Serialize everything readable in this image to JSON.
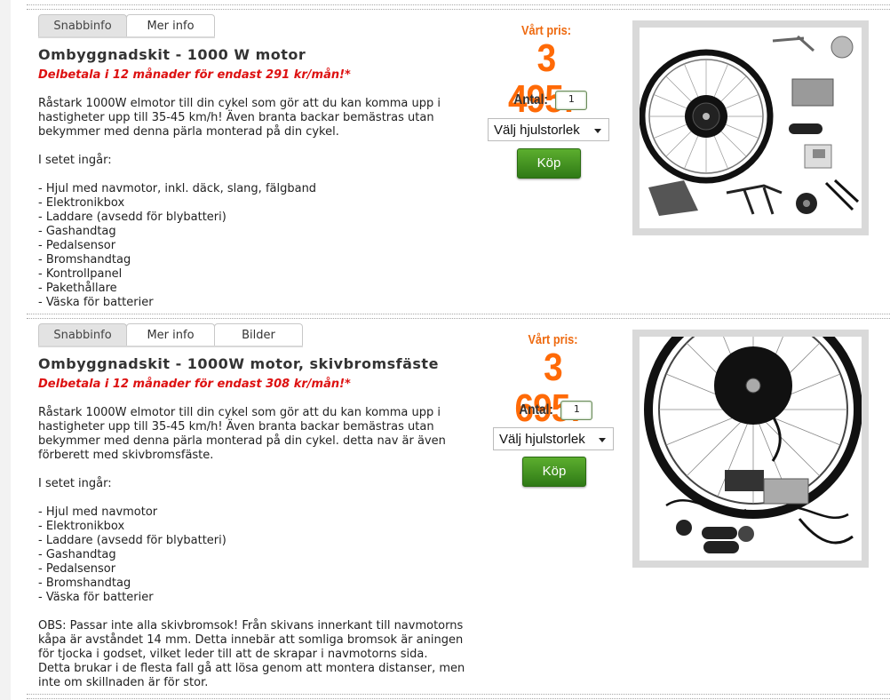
{
  "products": [
    {
      "tabs": [
        "Snabbinfo",
        "Mer info"
      ],
      "active_tab": "Snabbinfo",
      "title": "Ombyggnadskit - 1000 W motor",
      "installment": "Delbetala i 12 månader för endast 291 kr/mån!*",
      "description": "Råstark 1000W elmotor till din cykel som gör att du kan komma upp i\nhastigheter upp till 35-45 km/h! Även branta backar bemästras utan\nbekymmer med denna pärla monterad på din cykel.\n\nI setet ingår:\n\n- Hjul med navmotor, inkl. däck, slang, fälgband\n- Elektronikbox\n- Laddare (avsedd för blybatteri)\n- Gashandtag\n- Pedalsensor\n- Bromshandtag\n- Kontrollpanel\n- Pakethållare\n- Väska för batterier",
      "price_label": "Vårt pris:",
      "price": "3 495:-",
      "qty_label": "Antal:",
      "qty_value": "1",
      "wheel_select": "Välj hjulstorlek",
      "buy_label": "Köp"
    },
    {
      "tabs": [
        "Snabbinfo",
        "Mer info",
        "Bilder"
      ],
      "active_tab": "Snabbinfo",
      "title": "Ombyggnadskit - 1000W motor, skivbromsfäste",
      "installment": "Delbetala i 12 månader för endast 308 kr/mån!*",
      "description": "Råstark 1000W elmotor till din cykel som gör att du kan komma upp i\nhastigheter upp till 35-45 km/h! Även branta backar bemästras utan\nbekymmer med denna pärla monterad på din cykel. detta nav är även\nförberett med skivbromsfäste.\n\nI setet ingår:\n\n- Hjul med navmotor\n- Elektronikbox\n- Laddare (avsedd för blybatteri)\n- Gashandtag\n- Pedalsensor\n- Bromshandtag\n- Väska för batterier\n\nOBS: Passar inte alla skivbromsok! Från skivans innerkant till navmotorns\nkåpa är avståndet 14 mm. Detta innebär att somliga bromsok är aningen\nför tjocka i godset, vilket leder till att de skrapar i navmotorns sida.\nDetta brukar i de flesta fall gå att lösa genom att montera distanser, men\ninte om skillnaden är för stor.",
      "price_label": "Vårt pris:",
      "price": "3 695:-",
      "qty_label": "Antal:",
      "qty_value": "1",
      "wheel_select": "Välj hjulstorlek",
      "buy_label": "Köp"
    }
  ],
  "colors": {
    "price": "#ff6a06",
    "installment": "#dd1111",
    "buy": "#3f8f1e"
  }
}
